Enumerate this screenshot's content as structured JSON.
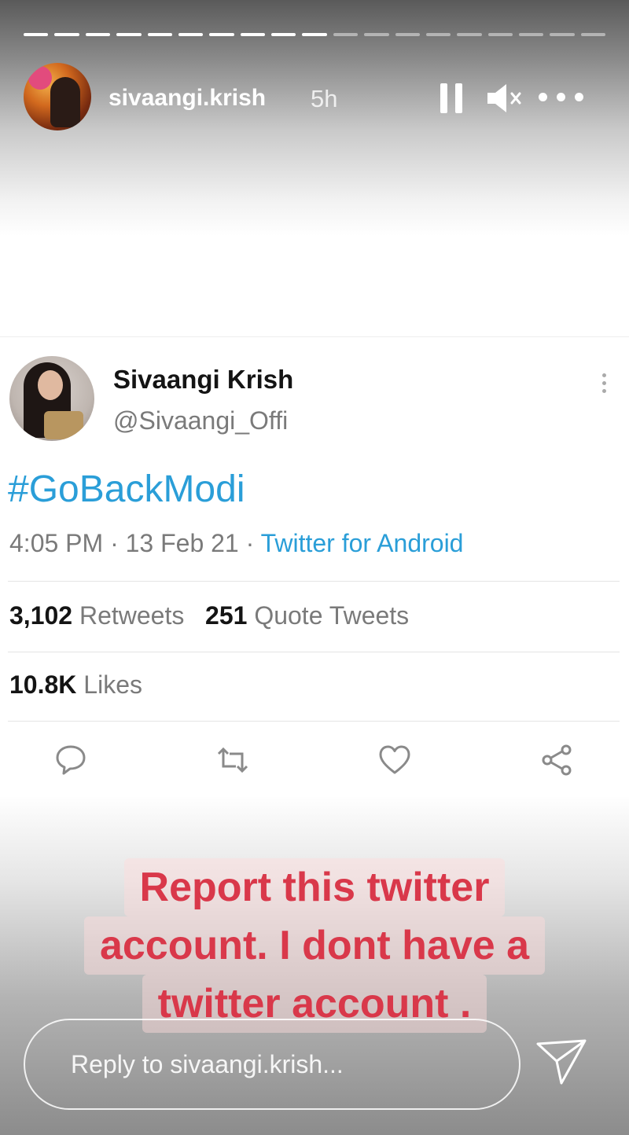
{
  "story": {
    "progress": {
      "segments_total": 19,
      "segments_done": 10
    },
    "username": "sivaangi.krish",
    "time": "5h",
    "icons": {
      "pause": "pause-icon",
      "mute": "mute-icon",
      "more": "more-icon",
      "send": "send-icon"
    }
  },
  "tweet": {
    "name": "Sivaangi Krish",
    "handle": "@Sivaangi_Offi",
    "text": "#GoBackModi",
    "timestamp": "4:05 PM · 13 Feb 21 · ",
    "source": "Twitter for Android",
    "retweets_count": "3,102",
    "retweets_label": " Retweets",
    "quotes_count": "251",
    "quotes_label": " Quote Tweets",
    "likes_count": "10.8K",
    "likes_label": " Likes",
    "actions": [
      "reply-icon",
      "retweet-icon",
      "like-icon",
      "share-icon"
    ]
  },
  "caption": {
    "lines": [
      "Report this twitter",
      "account. I dont have a",
      "twitter account ."
    ],
    "color": "#d9384a"
  },
  "reply": {
    "placeholder": "Reply to sivaangi.krish..."
  },
  "colors": {
    "link": "#2a9ed8",
    "muted": "#7a7a7a",
    "text": "#141414"
  }
}
